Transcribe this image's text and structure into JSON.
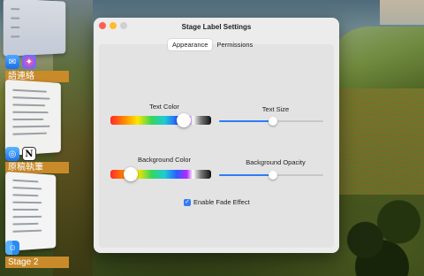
{
  "window": {
    "title": "Stage Label Settings",
    "tabs": [
      {
        "label": "Appearance",
        "active": true
      },
      {
        "label": "Permissions",
        "active": false
      }
    ],
    "text_color": {
      "label": "Text Color"
    },
    "text_size": {
      "label": "Text Size",
      "value": 0.5
    },
    "background_color": {
      "label": "Background Color"
    },
    "background_opacity": {
      "label": "Background Opacity",
      "value": 0.5
    },
    "fade_effect": {
      "label": "Enable Fade Effect",
      "checked": true
    }
  },
  "stage_manager": {
    "groups": [
      {
        "label": "語連絡",
        "icons": [
          "mail-icon",
          "messenger-icon"
        ]
      },
      {
        "label": "原稿執筆",
        "icons": [
          "safari-icon",
          "notion-icon"
        ]
      },
      {
        "label": "Stage 2",
        "icons": [
          "finder-icon"
        ]
      }
    ]
  },
  "colors": {
    "accent": "#2f7cf6",
    "stage_label_bg": "#c98a2a",
    "close": "#ff5f57",
    "minimize": "#febc2e"
  }
}
